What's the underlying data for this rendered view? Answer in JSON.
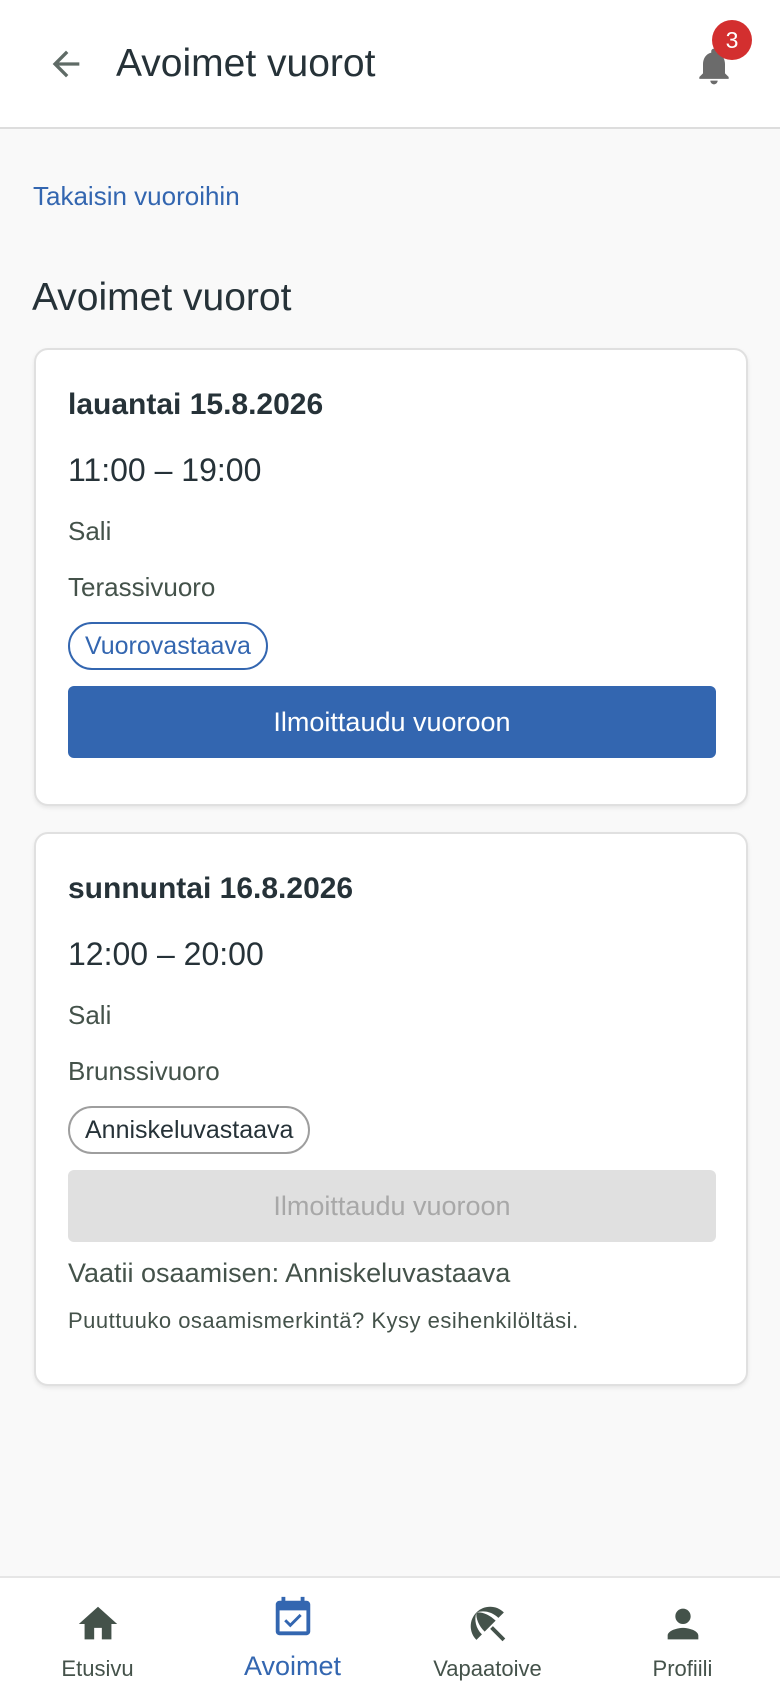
{
  "header": {
    "title": "Avoimet vuorot",
    "notification_count": "3"
  },
  "back_link": "Takaisin vuoroihin",
  "section_title": "Avoimet vuorot",
  "shifts": [
    {
      "date": "lauantai 15.8.2026",
      "time": "11:00 – 19:00",
      "location": "Sali",
      "shift_type": "Terassivuoro",
      "role": "Vuorovastaava",
      "button_label": "Ilmoittaudu vuoroon"
    },
    {
      "date": "sunnuntai 16.8.2026",
      "time": "12:00 – 20:00",
      "location": "Sali",
      "shift_type": "Brunssivuoro",
      "role": "Anniskeluvastaava",
      "button_label": "Ilmoittaudu vuoroon",
      "requirement": "Vaatii osaamisen: Anniskeluvastaava",
      "hint": "Puuttuuko osaamismerkintä? Kysy esihenkilöltäsi."
    }
  ],
  "bottom_nav": [
    {
      "label": "Etusivu",
      "icon": "home-icon"
    },
    {
      "label": "Avoimet",
      "icon": "calendar-check-icon"
    },
    {
      "label": "Vapaatoive",
      "icon": "beach-umbrella-icon"
    },
    {
      "label": "Profiili",
      "icon": "person-icon"
    }
  ],
  "colors": {
    "primary": "#3366b0",
    "badge": "#d32f2f",
    "icon": "#44524a"
  }
}
